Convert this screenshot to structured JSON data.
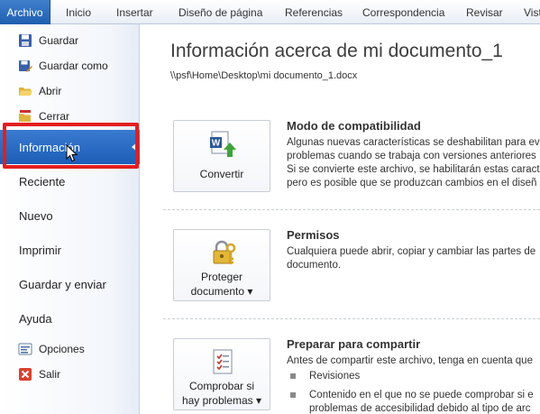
{
  "ribbon": {
    "file_tab": "Archivo",
    "tabs": [
      "Inicio",
      "Insertar",
      "Diseño de página",
      "Referencias",
      "Correspondencia",
      "Revisar",
      "Vist"
    ]
  },
  "backstage": {
    "commands_top": [
      "Guardar",
      "Guardar como",
      "Abrir",
      "Cerrar"
    ],
    "nav": [
      "Información",
      "Reciente",
      "Nuevo",
      "Imprimir",
      "Guardar y enviar",
      "Ayuda"
    ],
    "commands_bottom": [
      "Opciones",
      "Salir"
    ],
    "selected": "Información"
  },
  "info": {
    "title": "Información acerca de mi documento_1",
    "path": "\\\\psf\\Home\\Desktop\\mi documento_1.docx",
    "sections": [
      {
        "button_lines": [
          "Convertir"
        ],
        "title": "Modo de compatibilidad",
        "lines": [
          "Algunas nuevas características se deshabilitan para ev",
          "problemas cuando se trabaja con versiones anteriores",
          "Si se convierte este archivo, se habilitarán estas caract",
          "pero es posible que se produzcan cambios en el diseñ"
        ]
      },
      {
        "button_lines": [
          "Proteger",
          "documento ▾"
        ],
        "title": "Permisos",
        "lines": [
          "Cualquiera puede abrir, copiar y cambiar las partes de",
          "documento."
        ]
      },
      {
        "button_lines": [
          "Comprobar si",
          "hay problemas ▾"
        ],
        "title": "Preparar para compartir",
        "lines": [
          "Antes de compartir este archivo, tenga en cuenta que"
        ],
        "bullets": [
          "Revisiones",
          "Contenido en el que no se puede comprobar si e"
        ],
        "bullet_continuation": "problemas de accesibilidad debido al tipo de arc"
      }
    ]
  },
  "colors": {
    "file_tab": "#2a6bbf",
    "selected_nav": "#2b6cc4",
    "highlight_box": "#e31e1e"
  }
}
